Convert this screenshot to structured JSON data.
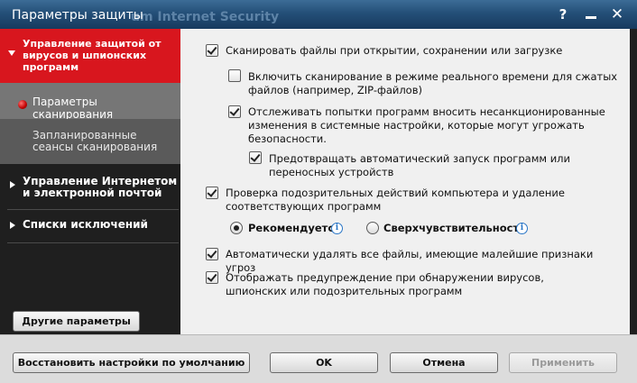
{
  "window": {
    "title": "Параметры защиты",
    "ghost_title": "um Internet Security",
    "help_label": "?",
    "close_label": "✕"
  },
  "sidebar": {
    "active_section": "Управление защитой от вирусов и шпионских программ",
    "sub_items": [
      {
        "label": "Параметры сканирования",
        "selected": true
      },
      {
        "label": "Запланированные сеансы сканирования",
        "selected": false
      }
    ],
    "sections": [
      {
        "label": "Управление Интернетом и электронной почтой"
      },
      {
        "label": "Списки исключений"
      }
    ],
    "other_params_button": "Другие параметры"
  },
  "options": {
    "scan_on_open": {
      "label": "Сканировать файлы при открытии, сохранении или загрузке",
      "checked": true
    },
    "realtime_compressed": {
      "label": "Включить сканирование в режиме реального времени для сжатых файлов (например, ZIP-файлов)",
      "checked": false
    },
    "track_changes": {
      "label": "Отслеживать попытки программ вносить несанкционированные изменения в системные настройки, которые могут угрожать безопасности.",
      "checked": true
    },
    "prevent_autorun": {
      "label": "Предотвращать автоматический запуск программ или переносных устройств",
      "checked": true
    },
    "suspicious_actions": {
      "label": "Проверка подозрительных действий компьютера и удаление соответствующих программ",
      "checked": true
    },
    "radio_recommended": {
      "label": "Рекомендуется",
      "selected": true
    },
    "radio_hypersensitive": {
      "label": "Сверхчувствительность",
      "selected": false
    },
    "auto_delete": {
      "label": "Автоматически удалять все файлы, имеющие малейшие признаки угроз",
      "checked": true
    },
    "show_warning": {
      "label": "Отображать предупреждение при обнаружении вирусов, шпионских или подозрительных программ",
      "checked": true
    }
  },
  "footer": {
    "restore_defaults": "Восстановить настройки по умолчанию",
    "ok": "OK",
    "cancel": "Отмена",
    "apply": "Применить"
  },
  "colors": {
    "active_section": "#d8161e",
    "sidebar_bg": "#1f1f1f",
    "info_icon": "#2a76c6"
  }
}
